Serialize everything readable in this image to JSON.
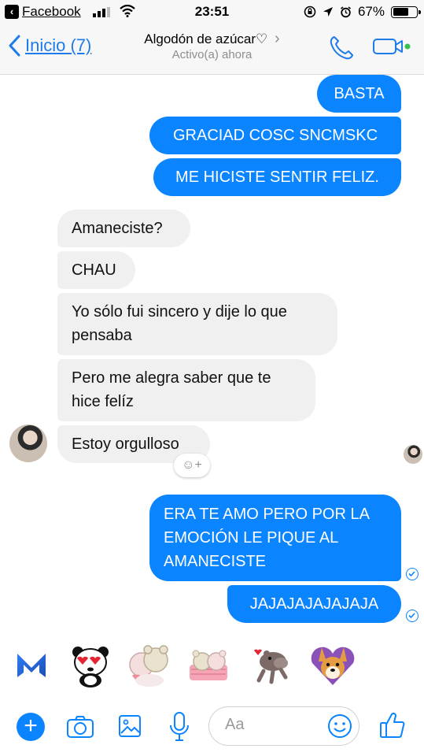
{
  "status_bar": {
    "back_app": "Facebook",
    "time": "23:51",
    "battery_percent": "67%",
    "battery_level": 0.67,
    "back_glyph": "‹"
  },
  "nav": {
    "back_label": "Inicio (7)",
    "title": "Algodón de azúcar♡",
    "title_chevron": "›",
    "subtitle": "Activo(a) ahora",
    "back_icon": "chevron-left-icon",
    "call_icon": "phone-icon",
    "video_icon": "video-camera-icon",
    "accent": "#1e7bea"
  },
  "messages": {
    "outgoing_top": [
      "BASTA",
      "GRACIAD COSC SNCMSKC",
      "ME HICISTE SENTIR FELIZ."
    ],
    "incoming": [
      {
        "lines": [
          "Amaneciste?"
        ]
      },
      {
        "lines": [
          "CHAU"
        ]
      },
      {
        "lines": [
          "Yo sólo fui sincero y dije lo que",
          "pensaba"
        ]
      },
      {
        "lines": [
          "Pero me alegra saber que te",
          "hice felíz"
        ]
      },
      {
        "lines": [
          "Estoy orgulloso"
        ]
      }
    ],
    "outgoing_bottom": [
      {
        "lines": [
          "ERA TE AMO PERO POR LA",
          "EMOCIÓN LE PIQUE AL",
          "AMANECISTE"
        ]
      },
      {
        "lines": [
          "JAJAJAJAJAJAJA"
        ]
      }
    ],
    "outgoing_color": "#0a84ff",
    "incoming_color": "#f1f0f0"
  },
  "reaction_button": {
    "icon": "add-reaction-icon",
    "glyph": "☺+"
  },
  "sticker_bar": {
    "items": [
      "messenger-m-icon",
      "panda-heart-eyes-sticker",
      "teddy-bears-hug-sticker",
      "bears-in-bed-sticker",
      "hippo-hearts-sticker",
      "corgi-heart-sticker"
    ]
  },
  "composer": {
    "plus_glyph": "+",
    "placeholder": "Aa",
    "icons": [
      "plus-icon",
      "camera-icon",
      "gallery-icon",
      "microphone-icon",
      "emoji-icon",
      "thumbs-up-icon"
    ]
  }
}
